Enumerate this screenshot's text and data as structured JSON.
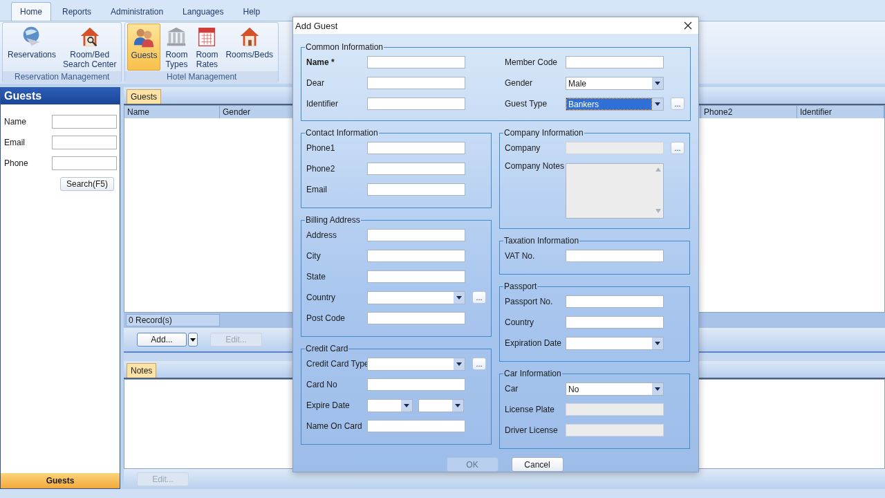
{
  "ribbon": {
    "tabs": [
      {
        "label": "Home",
        "selected": true
      },
      {
        "label": "Reports",
        "selected": false
      },
      {
        "label": "Administration",
        "selected": false
      },
      {
        "label": "Languages",
        "selected": false
      },
      {
        "label": "Help",
        "selected": false
      }
    ],
    "groups": [
      {
        "title": "Reservation Management",
        "items": [
          {
            "label": "Reservations",
            "selected": false
          },
          {
            "label": "Room/Bed\nSearch Center",
            "selected": false
          }
        ]
      },
      {
        "title": "Hotel Management",
        "items": [
          {
            "label": "Guests",
            "selected": true
          },
          {
            "label": "Room\nTypes",
            "selected": false
          },
          {
            "label": "Room\nRates",
            "selected": false
          },
          {
            "label": "Rooms/Beds",
            "selected": false
          }
        ]
      }
    ]
  },
  "search_panel": {
    "title": "Guests",
    "fields": [
      {
        "label": "Name"
      },
      {
        "label": "Email"
      },
      {
        "label": "Phone"
      }
    ],
    "button": "Search(F5)",
    "footer": "Guests"
  },
  "guests_tab": {
    "tab": "Guests",
    "columns": [
      "Name",
      "Gender",
      "Phone2",
      "Identifier"
    ],
    "record_count": "0 Record(s)",
    "add_button": "Add...",
    "edit_button": {
      "label": "Edit...",
      "disabled": true
    }
  },
  "notes_tab": {
    "tab": "Notes",
    "edit_button": {
      "label": "Edit...",
      "disabled": true
    }
  },
  "dialog": {
    "title": "Add Guest",
    "common": {
      "title": "Common Information",
      "left": [
        {
          "label": "Name *",
          "bold": true,
          "kind": "text",
          "disabled": false
        },
        {
          "label": "Dear",
          "kind": "text",
          "disabled": false
        },
        {
          "label": "Identifier",
          "kind": "text",
          "disabled": false
        }
      ],
      "right": [
        {
          "label": "Member Code",
          "kind": "text",
          "disabled": false
        },
        {
          "label": "Gender",
          "kind": "combo",
          "value": "Male",
          "highlighted": false,
          "disabled": false
        },
        {
          "label": "Guest Type",
          "kind": "combo",
          "value": "Bankers",
          "highlighted": true,
          "disabled": false,
          "browse": "..."
        }
      ]
    },
    "left_groups": [
      {
        "title": "Contact Information",
        "fields": [
          {
            "label": "Phone1",
            "kind": "text",
            "disabled": false
          },
          {
            "label": "Phone2",
            "kind": "text",
            "disabled": false
          },
          {
            "label": "Email",
            "kind": "text",
            "disabled": false
          }
        ]
      },
      {
        "title": "Billing Address",
        "fields": [
          {
            "label": "Address",
            "kind": "text",
            "disabled": false
          },
          {
            "label": "City",
            "kind": "text",
            "disabled": false
          },
          {
            "label": "State",
            "kind": "text",
            "disabled": false
          },
          {
            "label": "Country",
            "kind": "combo",
            "disabled": false,
            "browse": "..."
          },
          {
            "label": "Post Code",
            "kind": "text",
            "disabled": false
          }
        ]
      },
      {
        "title": "Credit Card",
        "fields": [
          {
            "label": "Credit Card Type",
            "kind": "combo",
            "disabled": false,
            "browse": "..."
          },
          {
            "label": "Card No",
            "kind": "text",
            "disabled": false
          },
          {
            "label": "Expire Date",
            "kind": "date-pair",
            "disabled": false
          },
          {
            "label": "Name On Card",
            "kind": "text",
            "disabled": false
          }
        ]
      }
    ],
    "right_groups": [
      {
        "title": "Company Information",
        "fields": [
          {
            "label": "Company",
            "kind": "text",
            "disabled": true,
            "browse": "..."
          },
          {
            "label": "Company Notes",
            "kind": "textarea",
            "disabled": true
          }
        ]
      },
      {
        "title": "Taxation Information",
        "fields": [
          {
            "label": "VAT No.",
            "kind": "text",
            "disabled": false
          }
        ]
      },
      {
        "title": "Passport",
        "fields": [
          {
            "label": "Passport No.",
            "kind": "text",
            "disabled": false
          },
          {
            "label": "Country",
            "kind": "text",
            "disabled": false
          },
          {
            "label": "Expiration Date",
            "kind": "combo",
            "disabled": false
          }
        ]
      },
      {
        "title": "Car Information",
        "fields": [
          {
            "label": "Car",
            "kind": "combo",
            "value": "No",
            "highlighted": false,
            "disabled": false
          },
          {
            "label": "License Plate",
            "kind": "text",
            "disabled": true
          },
          {
            "label": "Driver License",
            "kind": "text",
            "disabled": true
          }
        ]
      }
    ],
    "buttons": [
      {
        "label": "OK",
        "disabled": true
      },
      {
        "label": "Cancel",
        "disabled": false
      }
    ]
  }
}
